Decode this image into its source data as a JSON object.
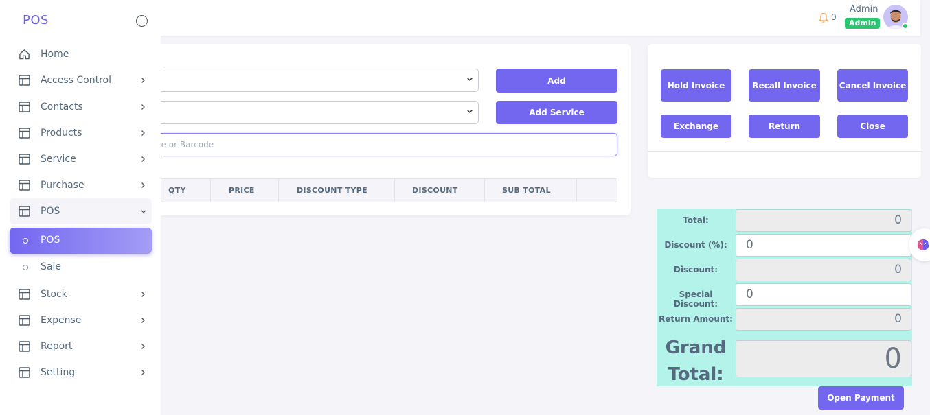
{
  "sidebar": {
    "brand": "POS",
    "items": [
      {
        "label": "Home"
      },
      {
        "label": "Access Control"
      },
      {
        "label": "Contacts"
      },
      {
        "label": "Products"
      },
      {
        "label": "Service"
      },
      {
        "label": "Purchase"
      },
      {
        "label": "POS"
      },
      {
        "label": "Stock"
      },
      {
        "label": "Expense"
      },
      {
        "label": "Report"
      },
      {
        "label": "Setting"
      }
    ],
    "pos_sub": [
      {
        "label": "POS"
      },
      {
        "label": "Sale"
      }
    ]
  },
  "topbar": {
    "notification_count": "0",
    "user_name": "Admin",
    "user_role": "Admin"
  },
  "pos": {
    "add_label": "Add",
    "add_service_label": "Add Service",
    "search_placeholder": "ne or Barcode",
    "columns": [
      "QTY",
      "PRICE",
      "DISCOUNT TYPE",
      "DISCOUNT",
      "SUB TOTAL"
    ]
  },
  "actions": {
    "hold_invoice": "Hold Invoice",
    "recall_invoice": "Recall Invoice",
    "cancel_invoice": "Cancel Invoice",
    "exchange": "Exchange",
    "return": "Return",
    "close": "Close"
  },
  "totals": {
    "total_label": "Total:",
    "total_value": "0",
    "discount_pct_label": "Discount (%):",
    "discount_pct_value": "0",
    "discount_label": "Discount:",
    "discount_value": "0",
    "special_discount_label": "Special Discount:",
    "special_discount_value": "0",
    "return_amount_label": "Return Amount:",
    "return_amount_value": "0",
    "grand_total_label": "Grand Total:",
    "grand_total_value": "0",
    "open_payment_label": "Open Payment"
  },
  "colors": {
    "primary": "#7367f0",
    "success": "#28c76f",
    "totals_bg": "#b4f3ea"
  }
}
